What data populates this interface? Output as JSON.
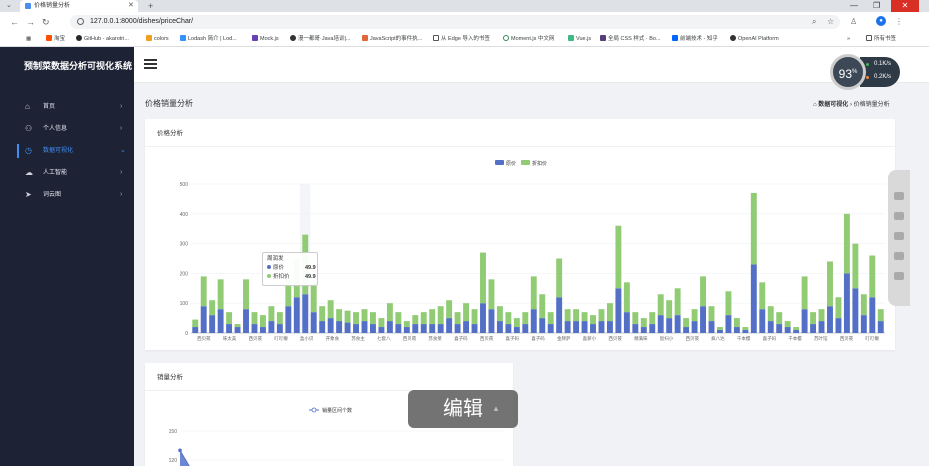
{
  "browser": {
    "tab_title": "价格销量分析",
    "url": "127.0.0.1:8000/dishes/priceChar/",
    "bookmarks": [
      {
        "label": "淘宝",
        "color": "#ff5000"
      },
      {
        "label": "GitHub - akarotri...",
        "color": "#24292e"
      },
      {
        "label": "colors",
        "color": "#f0a020"
      },
      {
        "label": "Lodash 简介 | Lod...",
        "color": "#3492ff"
      },
      {
        "label": "Mock.js",
        "color": "#6a3fb4"
      },
      {
        "label": "漫一都哥·Java培训|...",
        "color": "#333333"
      },
      {
        "label": "JavaScript的事件执...",
        "color": "#e2663b"
      },
      {
        "label": "从 Edge 导入的书签",
        "color": "#555555"
      },
      {
        "label": "Moment.js 中文网",
        "color": "#2e8b57"
      },
      {
        "label": "Vue.js",
        "color": "#41b883"
      },
      {
        "label": "全局 CSS 样式 · Bo...",
        "color": "#563d7c"
      },
      {
        "label": "前端技术 - 知乎",
        "color": "#0066ff"
      },
      {
        "label": "OpenAI Platform",
        "color": "#333333"
      }
    ],
    "bookmarks_more": "»",
    "all_bookmarks": "所有书签"
  },
  "app": {
    "brand": "预制菜数据分析可视化系统",
    "menu": [
      {
        "label": "首页",
        "icon": "home-icon"
      },
      {
        "label": "个人信息",
        "icon": "user-icon"
      },
      {
        "label": "数据可视化",
        "icon": "chart-icon",
        "active": true
      },
      {
        "label": "人工智能",
        "icon": "cloud-icon"
      },
      {
        "label": "词云图",
        "icon": "send-icon"
      }
    ],
    "header": {
      "gauge": "93",
      "gauge_unit": "%",
      "up_speed": "0.1",
      "up_unit": "K/s",
      "down_speed": "0.2",
      "down_unit": "K/s"
    },
    "page_title": "价格销量分析",
    "breadcrumb": {
      "home": "数据可视化",
      "sep": "›",
      "current": "价格销量分析"
    },
    "edit_label": "编辑",
    "floatbar_labels": [
      "",
      "",
      "",
      "",
      ""
    ]
  },
  "chart_data": [
    {
      "type": "bar",
      "title": "价格分析",
      "legend": [
        "原价",
        "折扣价"
      ],
      "colors": [
        "#5470c6",
        "#91cc75"
      ],
      "ylim": [
        0,
        500
      ],
      "yticks": [
        0,
        100,
        200,
        300,
        400,
        500
      ],
      "categories": [
        "西贝莜",
        "味太美",
        "西贝莜",
        "叮叮懒",
        "盒小识",
        "开象食",
        "苏食主",
        "七套八",
        "西贝莜",
        "苏食莱",
        "喜子码",
        "西贝莜",
        "喜子码",
        "喜子码",
        "金牌萨",
        "喜萝小",
        "西贝莜",
        "精满味",
        "饭扫小",
        "西贝莜",
        "疯八达",
        "千本樱",
        "喜子码",
        "千本樱",
        "苏叶馆",
        "西贝莜",
        "叮叮懒"
      ],
      "series": [
        {
          "name": "原价",
          "values": [
            20,
            90,
            60,
            80,
            30,
            20,
            80,
            30,
            20,
            40,
            30,
            90,
            120,
            130,
            70,
            40,
            50,
            40,
            35,
            30,
            40,
            30,
            20,
            40,
            30,
            20,
            30,
            30,
            30,
            30,
            50,
            30,
            40,
            30,
            100,
            80,
            40,
            30,
            20,
            30,
            80,
            50,
            30,
            120,
            40,
            40,
            40,
            30,
            40,
            40,
            150,
            70,
            30,
            20,
            30,
            60,
            50,
            60,
            20,
            40,
            90,
            40,
            10,
            60,
            20,
            10,
            230,
            80,
            40,
            30,
            20,
            10,
            80,
            30,
            40,
            90,
            50,
            200,
            150,
            60,
            120,
            40
          ]
        },
        {
          "name": "折扣价",
          "values": [
            25,
            100,
            50,
            100,
            40,
            10,
            100,
            40,
            40,
            50,
            40,
            90,
            130,
            200,
            100,
            50,
            60,
            40,
            40,
            40,
            40,
            40,
            30,
            60,
            40,
            20,
            30,
            40,
            50,
            60,
            60,
            40,
            60,
            50,
            170,
            100,
            50,
            40,
            30,
            40,
            110,
            80,
            40,
            130,
            40,
            40,
            30,
            30,
            40,
            60,
            210,
            100,
            40,
            30,
            40,
            70,
            60,
            90,
            30,
            40,
            100,
            50,
            10,
            80,
            30,
            10,
            240,
            90,
            50,
            40,
            20,
            10,
            110,
            40,
            40,
            150,
            70,
            200,
            150,
            70,
            140,
            40
          ]
        }
      ],
      "tooltip": {
        "category": "周润发",
        "rows": [
          {
            "name": "原价",
            "value": "49.9"
          },
          {
            "name": "折扣价",
            "value": "49.9"
          }
        ]
      }
    },
    {
      "type": "area",
      "title": "销量分析",
      "legend": [
        "销量区间个数"
      ],
      "yticks": [
        120,
        150
      ],
      "series": [
        {
          "name": "销量区间个数",
          "values": [
            130,
            100
          ]
        }
      ]
    }
  ]
}
